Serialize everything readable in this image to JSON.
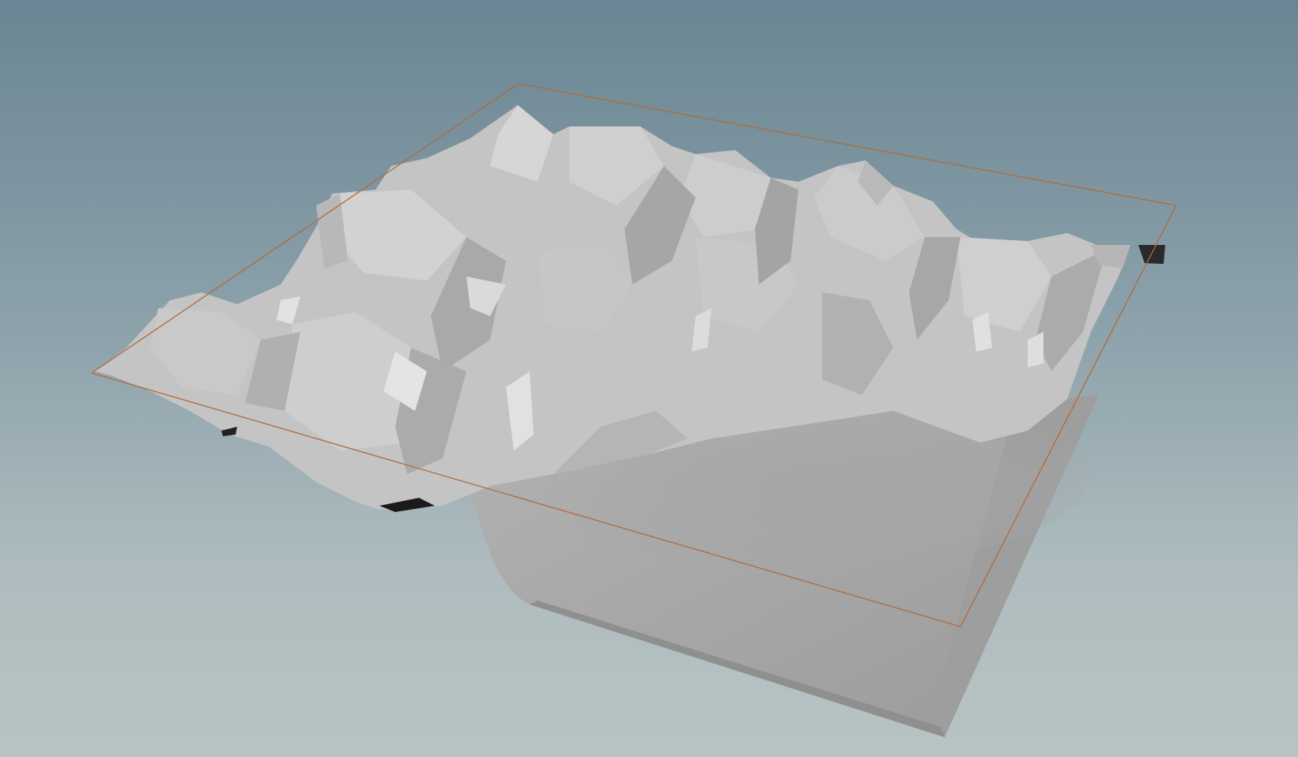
{
  "viewport": {
    "kind": "3d-viewport",
    "background_top": "#6a8593",
    "background_bottom": "#b8c3c3"
  },
  "scene": {
    "object": "heightfield-terrain",
    "shading": "flat-grey",
    "surface_color": "#bdbdbd",
    "bounding_box_color": "#b06a3a",
    "handles": []
  }
}
